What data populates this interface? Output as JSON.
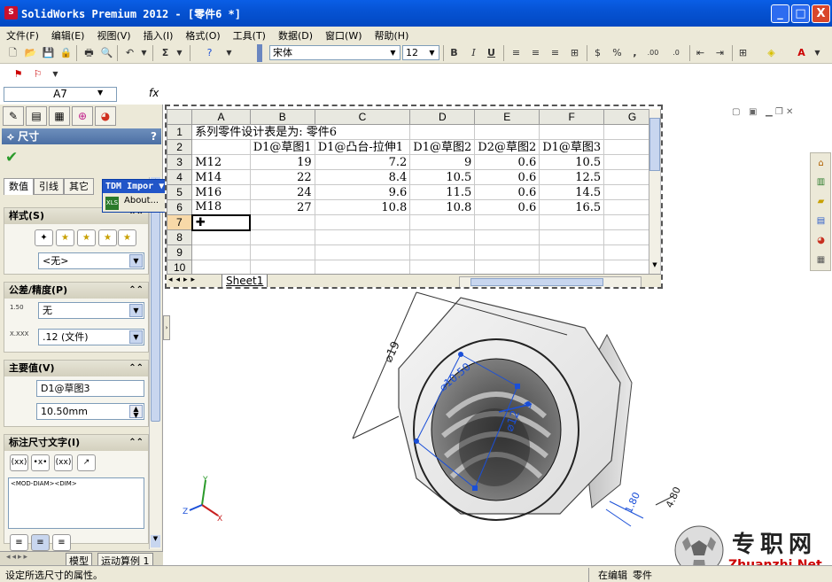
{
  "window": {
    "title": "SolidWorks Premium 2012 - [零件6 *]",
    "minimize": "_",
    "maximize": "□",
    "close": "X"
  },
  "menu": [
    "文件(F)",
    "编辑(E)",
    "视图(V)",
    "插入(I)",
    "格式(O)",
    "工具(T)",
    "数据(D)",
    "窗口(W)",
    "帮助(H)"
  ],
  "toolbar": {
    "font_name": "宋体",
    "font_size": "12",
    "bold": "B",
    "italic": "I",
    "underline": "U",
    "sigma": "Σ",
    "percent": "%",
    "comma": ",",
    "dec_inc": ".00",
    "dec_dec": ".0"
  },
  "formula_bar": {
    "cell_ref": "A7",
    "fx": "fx"
  },
  "property_manager": {
    "title": "尺寸",
    "help": "?",
    "tabs": [
      "数值",
      "引线",
      "其它"
    ],
    "style_section": {
      "title": "样式(S)",
      "combo": "<无>"
    },
    "tolerance_section": {
      "title": "公差/精度(P)",
      "tolerance_type": "无",
      "precision": ".12 (文件)",
      "icon1": "1.50",
      "icon2": "X.XXX"
    },
    "primary_section": {
      "title": "主要值(V)",
      "name": "D1@草图3",
      "value": "10.50mm"
    },
    "text_section": {
      "title": "标注尺寸文字(I)",
      "text": "<MOD-DIAM><DIM>",
      "btn1": "(xx)",
      "btn2": "•x•",
      "btn3": "(xx)"
    }
  },
  "spreadsheet": {
    "columns": [
      "A",
      "B",
      "C",
      "D",
      "E",
      "F",
      "G"
    ],
    "rows": [
      {
        "n": "1",
        "cells": [
          "系列零件设计表是为:  零件6",
          "",
          "",
          "",
          "",
          "",
          ""
        ]
      },
      {
        "n": "2",
        "cells": [
          "",
          "D1@草图1",
          "D1@凸台-拉伸1",
          "D1@草图2",
          "D2@草图2",
          "D1@草图3",
          ""
        ]
      },
      {
        "n": "3",
        "cells": [
          "M12",
          "19",
          "7.2",
          "9",
          "0.6",
          "10.5",
          ""
        ]
      },
      {
        "n": "4",
        "cells": [
          "M14",
          "22",
          "8.4",
          "10.5",
          "0.6",
          "12.5",
          ""
        ]
      },
      {
        "n": "5",
        "cells": [
          "M16",
          "24",
          "9.6",
          "11.5",
          "0.6",
          "14.5",
          ""
        ]
      },
      {
        "n": "6",
        "cells": [
          "M18",
          "27",
          "10.8",
          "10.8",
          "0.6",
          "16.5",
          ""
        ]
      },
      {
        "n": "7",
        "cells": [
          "",
          "",
          "",
          "",
          "",
          "",
          ""
        ]
      },
      {
        "n": "8",
        "cells": [
          "",
          "",
          "",
          "",
          "",
          "",
          ""
        ]
      },
      {
        "n": "9",
        "cells": [
          "",
          "",
          "",
          "",
          "",
          "",
          ""
        ]
      },
      {
        "n": "10",
        "cells": [
          "",
          "",
          "",
          "",
          "",
          "",
          ""
        ]
      }
    ],
    "sheet_tab": "Sheet1"
  },
  "tdm_popup": {
    "title": "TDM Impor ▼",
    "item": "About..."
  },
  "bottom_tabs": [
    "模型",
    "运动算例 1"
  ],
  "status": {
    "left": "设定所选尺寸的属性。",
    "mode": "在编辑",
    "doc": "零件"
  },
  "dimensions": {
    "d1": "⌀19",
    "d2": "⌀10.50",
    "d3": "⌀12",
    "d4": "3",
    "d5": "1.80",
    "d6": "4.80"
  },
  "axes": {
    "x": "X",
    "y": "Y",
    "z": "Z"
  },
  "watermark": {
    "cn": "专职网",
    "url": "Zhuanzhi.Net"
  },
  "colors": {
    "title_blue": "#0653d4",
    "chrome": "#ece9d8",
    "dim_blue": "#1a4fd8"
  }
}
